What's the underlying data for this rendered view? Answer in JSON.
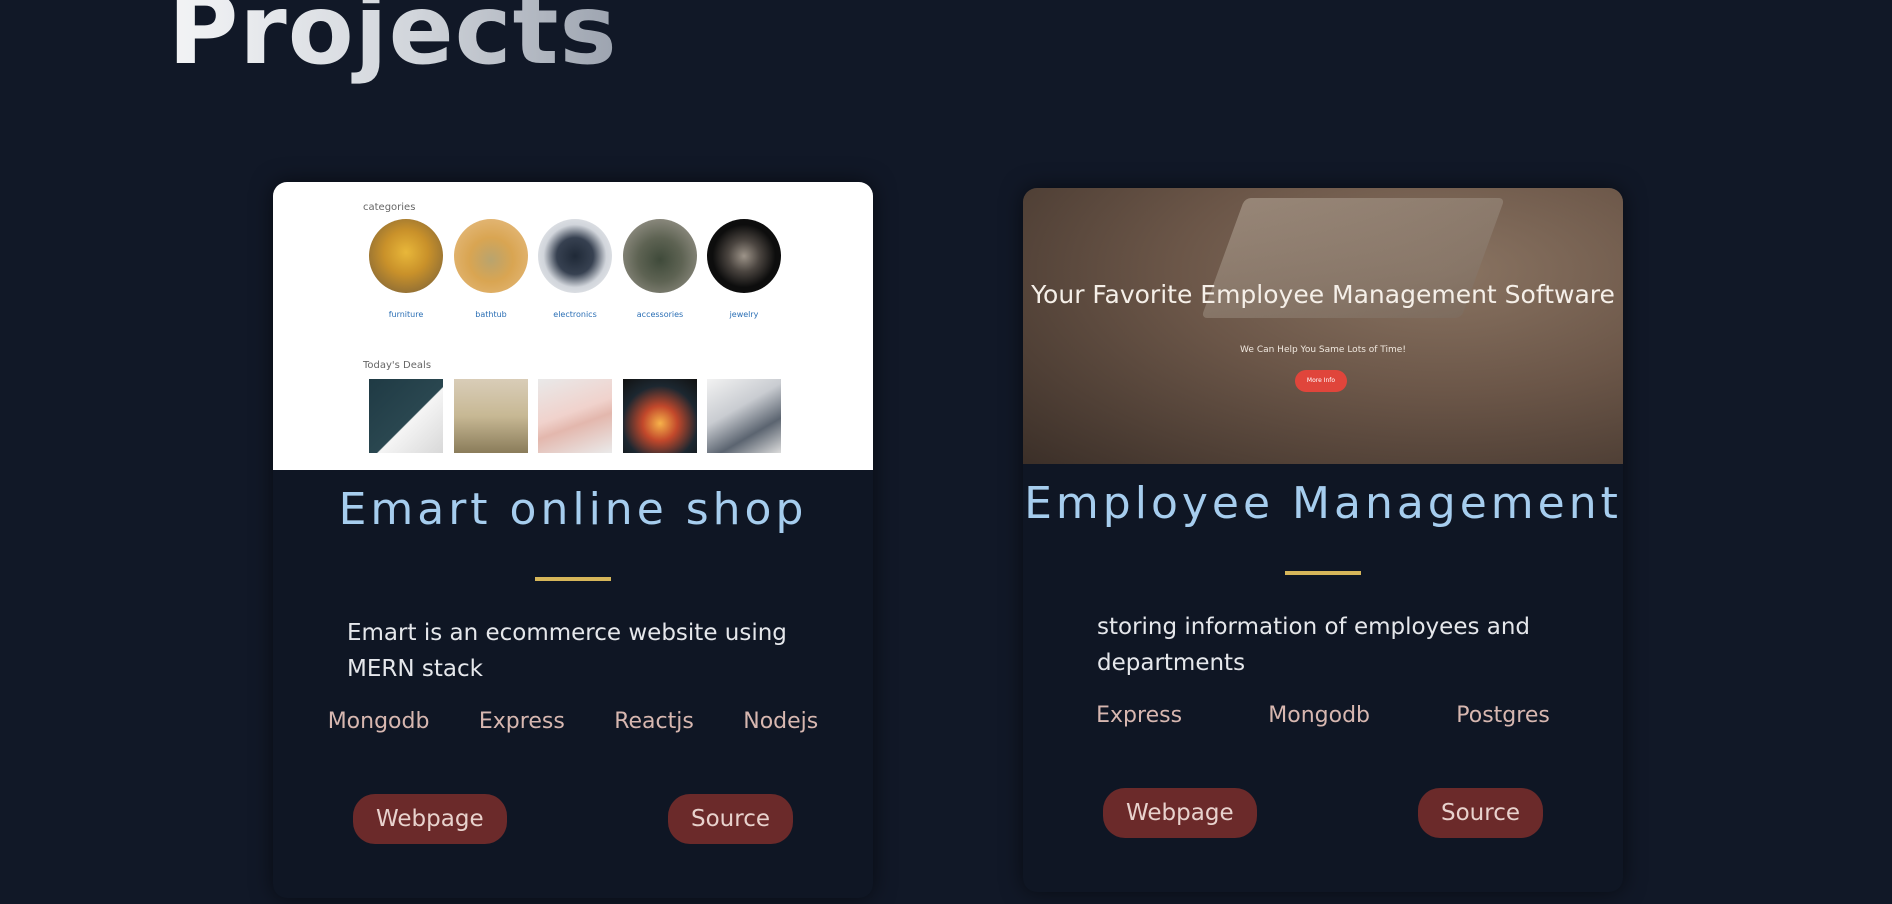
{
  "section": {
    "title": "Projects"
  },
  "projects": [
    {
      "title": "Emart online shop",
      "description": "Emart is an ecommerce website using MERN stack",
      "tags": [
        "Mongodb",
        "Express",
        "Reactjs",
        "Nodejs"
      ],
      "webpage_label": "Webpage",
      "source_label": "Source",
      "thumbnail": {
        "categories_heading": "categories",
        "categories": [
          "furniture",
          "bathtub",
          "electronics",
          "accessories",
          "jewelry"
        ],
        "deals_heading": "Today's Deals"
      }
    },
    {
      "title": "Employee Management",
      "description": "storing information of employees and departments",
      "tags": [
        "Express",
        "Mongodb",
        "Postgres"
      ],
      "webpage_label": "Webpage",
      "source_label": "Source",
      "thumbnail": {
        "hero_title": "Your Favorite Employee Management Software",
        "hero_subtitle": "We Can Help You Same Lots of Time!",
        "hero_button": "More Info"
      }
    }
  ],
  "colors": {
    "background": "#111827",
    "card": "#0f1624",
    "project_title": "#a6cdee",
    "divider": "#d6b65a",
    "button": "#6b2a2a"
  }
}
